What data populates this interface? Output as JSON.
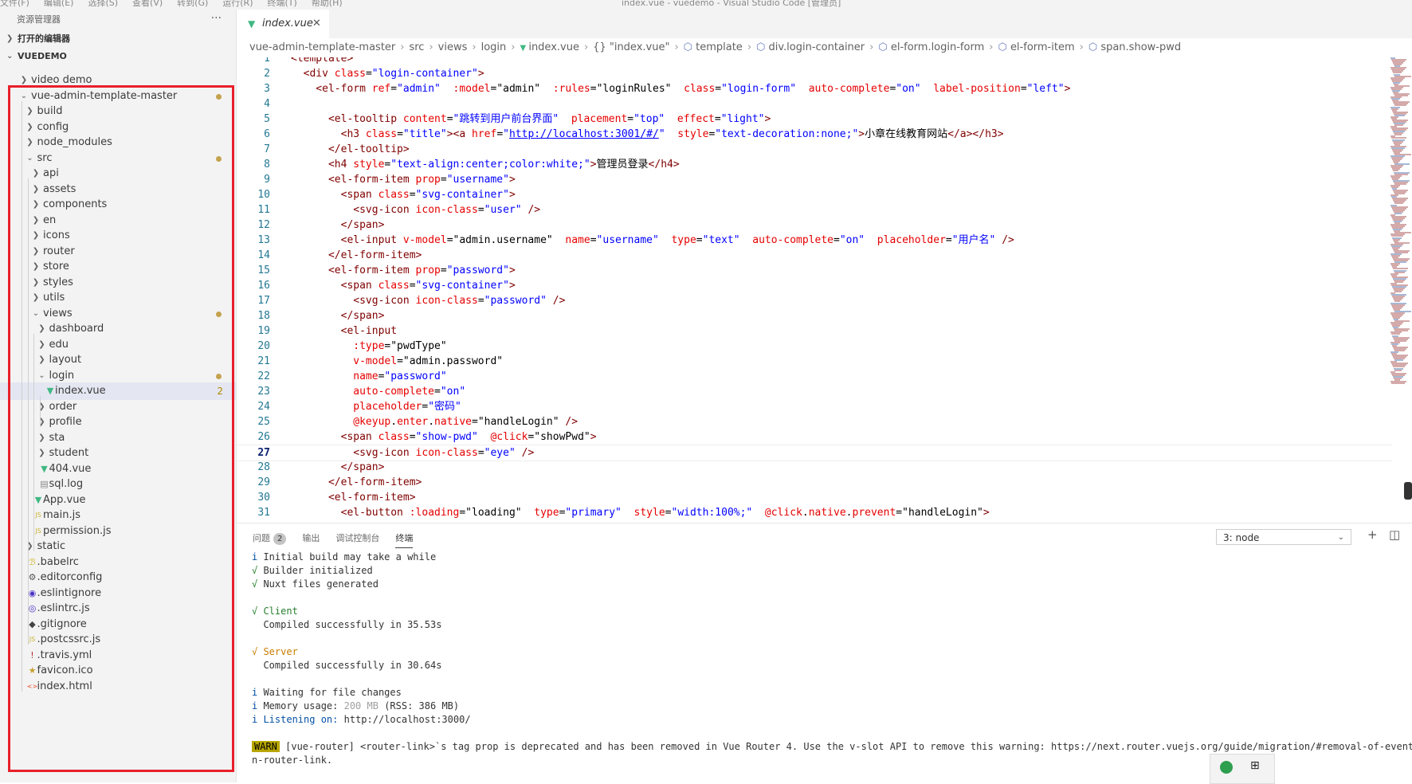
{
  "titlebar": {
    "menus": [
      "文件(F)",
      "编辑(E)",
      "选择(S)",
      "查看(V)",
      "转到(G)",
      "运行(R)",
      "终端(T)",
      "帮助(H)"
    ],
    "title": "index.vue - vuedemo - Visual Studio Code [管理员]"
  },
  "explorer": {
    "title": "资源管理器",
    "more": "···",
    "open_editors": "打开的编辑器",
    "workspace": "VUEDEMO"
  },
  "tree": [
    {
      "label": "video demo",
      "kind": "folder",
      "depth": 1,
      "open": false
    },
    {
      "label": "vue-admin-template-master",
      "kind": "folder",
      "depth": 1,
      "open": true,
      "modified": true
    },
    {
      "label": "build",
      "kind": "folder",
      "depth": 2,
      "open": false
    },
    {
      "label": "config",
      "kind": "folder",
      "depth": 2,
      "open": false
    },
    {
      "label": "node_modules",
      "kind": "folder",
      "depth": 2,
      "open": false
    },
    {
      "label": "src",
      "kind": "folder",
      "depth": 2,
      "open": true,
      "modified": true
    },
    {
      "label": "api",
      "kind": "folder",
      "depth": 3,
      "open": false
    },
    {
      "label": "assets",
      "kind": "folder",
      "depth": 3,
      "open": false
    },
    {
      "label": "components",
      "kind": "folder",
      "depth": 3,
      "open": false
    },
    {
      "label": "en",
      "kind": "folder",
      "depth": 3,
      "open": false
    },
    {
      "label": "icons",
      "kind": "folder",
      "depth": 3,
      "open": false
    },
    {
      "label": "router",
      "kind": "folder",
      "depth": 3,
      "open": false
    },
    {
      "label": "store",
      "kind": "folder",
      "depth": 3,
      "open": false
    },
    {
      "label": "styles",
      "kind": "folder",
      "depth": 3,
      "open": false
    },
    {
      "label": "utils",
      "kind": "folder",
      "depth": 3,
      "open": false
    },
    {
      "label": "views",
      "kind": "folder",
      "depth": 3,
      "open": true,
      "modified": true
    },
    {
      "label": "dashboard",
      "kind": "folder",
      "depth": 4,
      "open": false
    },
    {
      "label": "edu",
      "kind": "folder",
      "depth": 4,
      "open": false
    },
    {
      "label": "layout",
      "kind": "folder",
      "depth": 4,
      "open": false
    },
    {
      "label": "login",
      "kind": "folder",
      "depth": 4,
      "open": true,
      "modified": true
    },
    {
      "label": "index.vue",
      "kind": "vue",
      "depth": 5,
      "selected": true,
      "count": "2"
    },
    {
      "label": "order",
      "kind": "folder",
      "depth": 4,
      "open": false
    },
    {
      "label": "profile",
      "kind": "folder",
      "depth": 4,
      "open": false
    },
    {
      "label": "sta",
      "kind": "folder",
      "depth": 4,
      "open": false
    },
    {
      "label": "student",
      "kind": "folder",
      "depth": 4,
      "open": false
    },
    {
      "label": "404.vue",
      "kind": "vue",
      "depth": 4
    },
    {
      "label": "sql.log",
      "kind": "log",
      "depth": 4
    },
    {
      "label": "App.vue",
      "kind": "vue",
      "depth": 3
    },
    {
      "label": "main.js",
      "kind": "js",
      "depth": 3
    },
    {
      "label": "permission.js",
      "kind": "js",
      "depth": 3
    },
    {
      "label": "static",
      "kind": "folder",
      "depth": 2,
      "open": false
    },
    {
      "label": ".babelrc",
      "kind": "babel",
      "depth": 2
    },
    {
      "label": ".editorconfig",
      "kind": "gear",
      "depth": 2
    },
    {
      "label": ".eslintignore",
      "kind": "eslint",
      "depth": 2
    },
    {
      "label": ".eslintrc.js",
      "kind": "eslint-js",
      "depth": 2
    },
    {
      "label": ".gitignore",
      "kind": "git",
      "depth": 2
    },
    {
      "label": ".postcssrc.js",
      "kind": "js",
      "depth": 2
    },
    {
      "label": ".travis.yml",
      "kind": "yml",
      "depth": 2
    },
    {
      "label": "favicon.ico",
      "kind": "star",
      "depth": 2
    },
    {
      "label": "index.html",
      "kind": "html",
      "depth": 2
    }
  ],
  "tab": {
    "name": "index.vue",
    "close": "✕"
  },
  "breadcrumbs": {
    "items": [
      "vue-admin-template-master",
      "src",
      "views",
      "login"
    ],
    "file": "index.vue",
    "braces": "{} \"index.vue\"",
    "symbols": [
      "template",
      "div.login-container",
      "el-form.login-form",
      "el-form-item",
      "span.show-pwd"
    ]
  },
  "code": {
    "current_line": 27,
    "lines": [
      [
        [
          "t",
          "<template>"
        ]
      ],
      [
        [
          "t",
          "  <div "
        ],
        [
          "a",
          "class"
        ],
        [
          "x",
          "="
        ],
        [
          "s",
          "\"login-container\""
        ],
        [
          "t",
          ">"
        ]
      ],
      [
        [
          "t",
          "    <el-form "
        ],
        [
          "a",
          "ref"
        ],
        [
          "x",
          "="
        ],
        [
          "s",
          "\"admin\""
        ],
        [
          "x",
          "  "
        ],
        [
          "a",
          ":model"
        ],
        [
          "x",
          "="
        ],
        [
          "x",
          "\"admin\""
        ],
        [
          "x",
          "  "
        ],
        [
          "a",
          ":rules"
        ],
        [
          "x",
          "="
        ],
        [
          "x",
          "\"loginRules\""
        ],
        [
          "x",
          "  "
        ],
        [
          "a",
          "class"
        ],
        [
          "x",
          "="
        ],
        [
          "s",
          "\"login-form\""
        ],
        [
          "x",
          "  "
        ],
        [
          "a",
          "auto-complete"
        ],
        [
          "x",
          "="
        ],
        [
          "s",
          "\"on\""
        ],
        [
          "x",
          "  "
        ],
        [
          "a",
          "label-position"
        ],
        [
          "x",
          "="
        ],
        [
          "s",
          "\"left\""
        ],
        [
          "t",
          ">"
        ]
      ],
      [
        [
          "x",
          ""
        ]
      ],
      [
        [
          "t",
          "      <el-tooltip "
        ],
        [
          "a",
          "content"
        ],
        [
          "x",
          "="
        ],
        [
          "s",
          "\"跳转到用户前台界面\""
        ],
        [
          "x",
          "  "
        ],
        [
          "a",
          "placement"
        ],
        [
          "x",
          "="
        ],
        [
          "s",
          "\"top\""
        ],
        [
          "x",
          "  "
        ],
        [
          "a",
          "effect"
        ],
        [
          "x",
          "="
        ],
        [
          "s",
          "\"light\""
        ],
        [
          "t",
          ">"
        ]
      ],
      [
        [
          "t",
          "        <h3 "
        ],
        [
          "a",
          "class"
        ],
        [
          "x",
          "="
        ],
        [
          "s",
          "\"title\""
        ],
        [
          "t",
          "><a "
        ],
        [
          "a",
          "href"
        ],
        [
          "x",
          "="
        ],
        [
          "s",
          "\""
        ],
        [
          "u",
          "http://localhost:3001/#/"
        ],
        [
          "s",
          "\""
        ],
        [
          "x",
          "  "
        ],
        [
          "a",
          "style"
        ],
        [
          "x",
          "="
        ],
        [
          "s",
          "\"text-decoration:none;\""
        ],
        [
          "t",
          ">"
        ],
        [
          "x",
          "小章在线教育网站"
        ],
        [
          "t",
          "</a></h3>"
        ]
      ],
      [
        [
          "t",
          "      </el-tooltip>"
        ]
      ],
      [
        [
          "t",
          "      <h4 "
        ],
        [
          "a",
          "style"
        ],
        [
          "x",
          "="
        ],
        [
          "s",
          "\"text-align:center;color:white;\""
        ],
        [
          "t",
          ">"
        ],
        [
          "x",
          "管理员登录"
        ],
        [
          "t",
          "</h4>"
        ]
      ],
      [
        [
          "t",
          "      <el-form-item "
        ],
        [
          "a",
          "prop"
        ],
        [
          "x",
          "="
        ],
        [
          "s",
          "\"username\""
        ],
        [
          "t",
          ">"
        ]
      ],
      [
        [
          "t",
          "        <span "
        ],
        [
          "a",
          "class"
        ],
        [
          "x",
          "="
        ],
        [
          "s",
          "\"svg-container\""
        ],
        [
          "t",
          ">"
        ]
      ],
      [
        [
          "t",
          "          <svg-icon "
        ],
        [
          "a",
          "icon-class"
        ],
        [
          "x",
          "="
        ],
        [
          "s",
          "\"user\""
        ],
        [
          "x",
          " "
        ],
        [
          "t",
          "/>"
        ]
      ],
      [
        [
          "t",
          "        </span>"
        ]
      ],
      [
        [
          "t",
          "        <el-input "
        ],
        [
          "a",
          "v-model"
        ],
        [
          "x",
          "="
        ],
        [
          "x",
          "\"admin.username\""
        ],
        [
          "x",
          "  "
        ],
        [
          "a",
          "name"
        ],
        [
          "x",
          "="
        ],
        [
          "s",
          "\"username\""
        ],
        [
          "x",
          "  "
        ],
        [
          "a",
          "type"
        ],
        [
          "x",
          "="
        ],
        [
          "s",
          "\"text\""
        ],
        [
          "x",
          "  "
        ],
        [
          "a",
          "auto-complete"
        ],
        [
          "x",
          "="
        ],
        [
          "s",
          "\"on\""
        ],
        [
          "x",
          "  "
        ],
        [
          "a",
          "placeholder"
        ],
        [
          "x",
          "="
        ],
        [
          "s",
          "\"用户名\""
        ],
        [
          "x",
          " "
        ],
        [
          "t",
          "/>"
        ]
      ],
      [
        [
          "t",
          "      </el-form-item>"
        ]
      ],
      [
        [
          "t",
          "      <el-form-item "
        ],
        [
          "a",
          "prop"
        ],
        [
          "x",
          "="
        ],
        [
          "s",
          "\"password\""
        ],
        [
          "t",
          ">"
        ]
      ],
      [
        [
          "t",
          "        <span "
        ],
        [
          "a",
          "class"
        ],
        [
          "x",
          "="
        ],
        [
          "s",
          "\"svg-container\""
        ],
        [
          "t",
          ">"
        ]
      ],
      [
        [
          "t",
          "          <svg-icon "
        ],
        [
          "a",
          "icon-class"
        ],
        [
          "x",
          "="
        ],
        [
          "s",
          "\"password\""
        ],
        [
          "x",
          " "
        ],
        [
          "t",
          "/>"
        ]
      ],
      [
        [
          "t",
          "        </span>"
        ]
      ],
      [
        [
          "t",
          "        <el-input"
        ]
      ],
      [
        [
          "a",
          "          :type"
        ],
        [
          "x",
          "="
        ],
        [
          "x",
          "\"pwdType\""
        ]
      ],
      [
        [
          "a",
          "          v-model"
        ],
        [
          "x",
          "="
        ],
        [
          "x",
          "\"admin.password\""
        ]
      ],
      [
        [
          "a",
          "          name"
        ],
        [
          "x",
          "="
        ],
        [
          "s",
          "\"password\""
        ]
      ],
      [
        [
          "a",
          "          auto-complete"
        ],
        [
          "x",
          "="
        ],
        [
          "s",
          "\"on\""
        ]
      ],
      [
        [
          "a",
          "          placeholder"
        ],
        [
          "x",
          "="
        ],
        [
          "s",
          "\"密码\""
        ]
      ],
      [
        [
          "a",
          "          @keyup"
        ],
        [
          "x",
          "."
        ],
        [
          "a",
          "enter"
        ],
        [
          "x",
          "."
        ],
        [
          "a",
          "native"
        ],
        [
          "x",
          "="
        ],
        [
          "x",
          "\"handleLogin\""
        ],
        [
          "x",
          " "
        ],
        [
          "t",
          "/>"
        ]
      ],
      [
        [
          "t",
          "        <span "
        ],
        [
          "a",
          "class"
        ],
        [
          "x",
          "="
        ],
        [
          "s",
          "\"show-pwd\""
        ],
        [
          "x",
          "  "
        ],
        [
          "a",
          "@click"
        ],
        [
          "x",
          "="
        ],
        [
          "x",
          "\"showPwd\""
        ],
        [
          "t",
          ">"
        ]
      ],
      [
        [
          "t",
          "          <svg-icon "
        ],
        [
          "a",
          "icon-class"
        ],
        [
          "x",
          "="
        ],
        [
          "s",
          "\"eye\""
        ],
        [
          "x",
          " "
        ],
        [
          "t",
          "/>"
        ]
      ],
      [
        [
          "t",
          "        </span>"
        ]
      ],
      [
        [
          "t",
          "      </el-form-item>"
        ]
      ],
      [
        [
          "t",
          "      <el-form-item>"
        ]
      ],
      [
        [
          "t",
          "        <el-button "
        ],
        [
          "a",
          ":loading"
        ],
        [
          "x",
          "="
        ],
        [
          "x",
          "\"loading\""
        ],
        [
          "x",
          "  "
        ],
        [
          "a",
          "type"
        ],
        [
          "x",
          "="
        ],
        [
          "s",
          "\"primary\""
        ],
        [
          "x",
          "  "
        ],
        [
          "a",
          "style"
        ],
        [
          "x",
          "="
        ],
        [
          "s",
          "\"width:100%;\""
        ],
        [
          "x",
          "  "
        ],
        [
          "a",
          "@click"
        ],
        [
          "x",
          "."
        ],
        [
          "a",
          "native"
        ],
        [
          "x",
          "."
        ],
        [
          "a",
          "prevent"
        ],
        [
          "x",
          "="
        ],
        [
          "x",
          "\"handleLogin\""
        ],
        [
          "t",
          ">"
        ]
      ]
    ]
  },
  "panel": {
    "tabs": [
      "问题",
      "输出",
      "调试控制台",
      "终端"
    ],
    "problem_count": "2",
    "active_tab": "终端",
    "terminal_select": "3: node",
    "add_icon": "+",
    "split_icon": "◫"
  },
  "terminal": [
    [
      [
        "b",
        "i"
      ],
      [
        "x",
        " Initial build may take a while"
      ]
    ],
    [
      [
        "g",
        "√"
      ],
      [
        "x",
        " Builder initialized"
      ]
    ],
    [
      [
        "g",
        "√"
      ],
      [
        "x",
        " Nuxt files generated"
      ]
    ],
    [
      [
        "x",
        ""
      ]
    ],
    [
      [
        "g",
        "√ Client"
      ]
    ],
    [
      [
        "x",
        "  Compiled successfully in 35.53s"
      ]
    ],
    [
      [
        "x",
        ""
      ]
    ],
    [
      [
        "o",
        "√ Server"
      ]
    ],
    [
      [
        "x",
        "  Compiled successfully in 30.64s"
      ]
    ],
    [
      [
        "x",
        ""
      ]
    ],
    [
      [
        "b",
        "i"
      ],
      [
        "x",
        " Waiting for file changes"
      ]
    ],
    [
      [
        "b",
        "i"
      ],
      [
        "x",
        " Memory usage: "
      ],
      [
        "k",
        "200 MB"
      ],
      [
        "x",
        " (RSS: 386 MB)"
      ]
    ],
    [
      [
        "b",
        "i"
      ],
      [
        "b",
        " Listening on:"
      ],
      [
        "x",
        " http://localhost:3000/"
      ]
    ],
    [
      [
        "x",
        ""
      ]
    ],
    [
      [
        "w",
        "WARN"
      ],
      [
        "x",
        " [vue-router] <router-link>`s tag prop is deprecated and has been removed in Vue Router 4. Use the v-slot API to remove this warning: https://next.router.vuejs.org/guide/migration/#removal-of-event-and-"
      ]
    ],
    [
      [
        "x",
        "n-router-link."
      ]
    ]
  ],
  "colors": {
    "highlight_box": "#e8202a",
    "vue_green": "#41b883",
    "modified_dot": "#c4a24e",
    "accent": "#0451a5"
  }
}
